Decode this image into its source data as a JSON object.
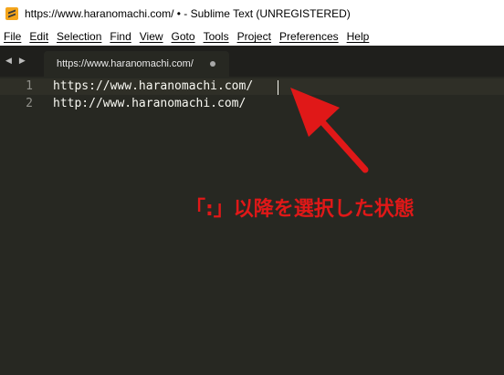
{
  "window": {
    "title": "https://www.haranomachi.com/ • - Sublime Text (UNREGISTERED)"
  },
  "menu": {
    "items": [
      "File",
      "Edit",
      "Selection",
      "Find",
      "View",
      "Goto",
      "Tools",
      "Project",
      "Preferences",
      "Help"
    ]
  },
  "tabs": {
    "nav_left": "◀",
    "nav_right": "▶",
    "items": [
      {
        "label": "https://www.haranomachi.com/",
        "modified": true
      }
    ]
  },
  "editor": {
    "lines": [
      {
        "number": "1",
        "text": "https://www.haranomachi.com/"
      },
      {
        "number": "2",
        "text": "http://www.haranomachi.com/"
      }
    ]
  },
  "annotation": {
    "text": "「:」以降を選択した状態",
    "color": "#e01818"
  }
}
